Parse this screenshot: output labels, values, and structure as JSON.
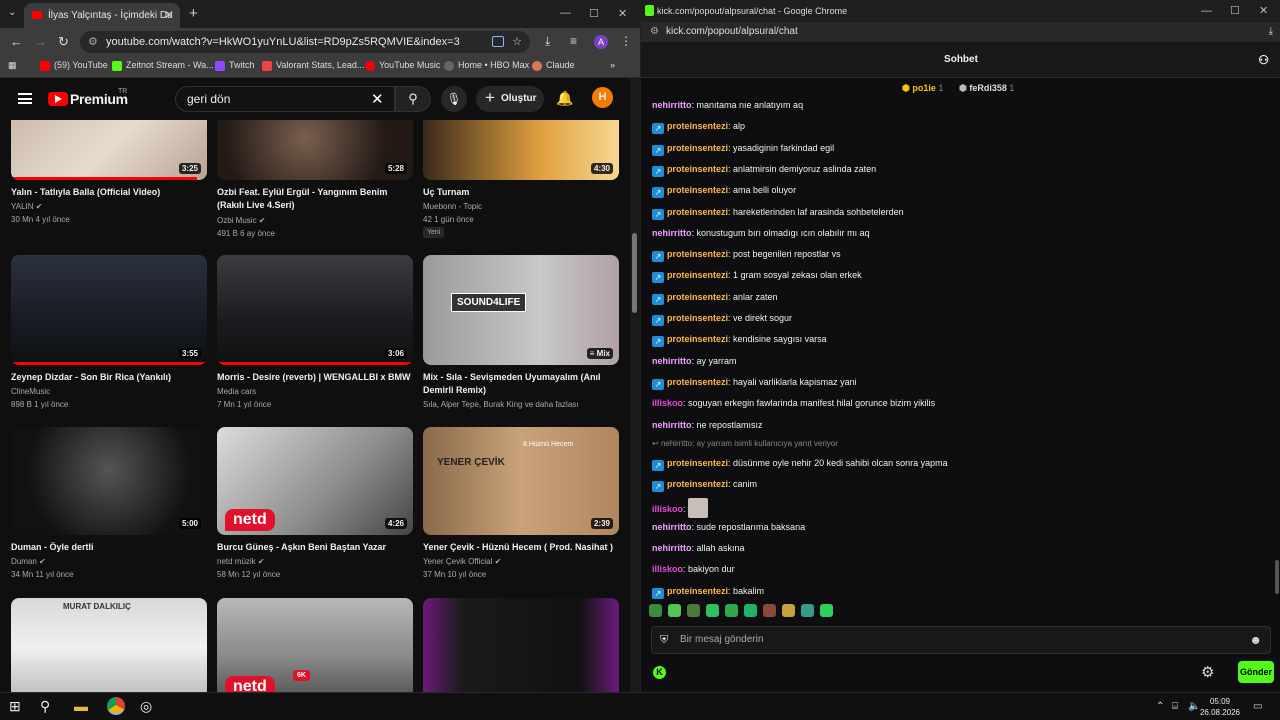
{
  "left_window": {
    "tab_title": "İlyas Yalçıntaş - İçimdeki Du",
    "url": "youtube.com/watch?v=HkWO1yuYnLU&list=RD9pZs5RQMVIE&index=3",
    "account_initial": "A",
    "bookmarks": [
      {
        "label": "(59) YouTube",
        "color": "#f00"
      },
      {
        "label": "Zeitnot Stream - Wa...",
        "color": "#53fc18"
      },
      {
        "label": "Twitch",
        "color": "#9146ff"
      },
      {
        "label": "Valorant Stats, Lead...",
        "color": "#e44"
      },
      {
        "label": "YouTube Music",
        "color": "#f00"
      },
      {
        "label": "Home • HBO Max",
        "color": "#666"
      },
      {
        "label": "Claude",
        "color": "#d97757"
      }
    ]
  },
  "youtube": {
    "logo_text": "Premium",
    "region": "TR",
    "search_value": "geri dön",
    "create_label": "Oluştur",
    "avatar_initial": "H",
    "videos": [
      {
        "title": "Yalın - Tatlıyla Balla (Official Video)",
        "channel": "YALIN",
        "meta": "30 Mn   4 yıl önce",
        "duration": "3:25",
        "verified": true,
        "progress": 0.95
      },
      {
        "title": "Ozbi Feat. Eylül Ergül - Yangınım Benim (Rakılı Live 4.Seri)",
        "channel": "Ozbi Music",
        "meta": "491 B   6 ay önce",
        "duration": "5:28",
        "verified": true,
        "progress": 0.0
      },
      {
        "title": "Uç Turnam",
        "channel": "Muebonn - Topic",
        "meta": "42   1 gün önce",
        "duration": "4:30",
        "verified": false,
        "badge": "Yeni",
        "progress": 0.0
      },
      {
        "title": "Zeynep Dizdar - Son Bir Rica (Yankılı)",
        "channel": "ClineMusic",
        "meta": "898 B   1 yıl önce",
        "duration": "3:55",
        "verified": false,
        "progress": 1.0
      },
      {
        "title": "Morris - Desire (reverb) | WENGALLBI x BMW",
        "channel": "Media cars",
        "meta": "7 Mn   1 yıl önce",
        "duration": "3:06",
        "verified": false,
        "progress": 1.0
      },
      {
        "title": "Mix - Sıla - Sevişmeden Uyumayalım (Anıl Demirli Remix)",
        "channel": "Sıla, Alper Tepe, Burak King ve daha fazlası",
        "meta": "",
        "duration": "Mix",
        "verified": false,
        "progress": 0.0
      },
      {
        "title": "Duman - Öyle dertli",
        "channel": "Duman",
        "meta": "34 Mn   11 yıl önce",
        "duration": "5:00",
        "verified": true,
        "progress": 0.0
      },
      {
        "title": "Burcu Güneş - Aşkın Beni Baştan Yazar",
        "channel": "netd müzik",
        "meta": "58 Mn   12 yıl önce",
        "duration": "4:26",
        "verified": true,
        "progress": 0.0
      },
      {
        "title": "Yener Çevik - Hüznü Hecem ( Prod. Nasihat )",
        "channel": "Yener Çevik Official",
        "meta": "37 Mn   10 yıl önce",
        "duration": "2:39",
        "verified": true,
        "progress": 0.0
      }
    ],
    "thumb_texts": {
      "sound4life": "SOUND4LIFE",
      "netd": "netd",
      "yener_album": "YENER ÇEVİK",
      "yener_track": "8.Hüznü Hecem",
      "murat": "MURAT DALKILIÇ",
      "sixk": "6K"
    }
  },
  "right_window": {
    "title": "kick.com/popout/alpsural/chat - Google Chrome",
    "url": "kick.com/popout/alpsural/chat",
    "chat_title": "Sohbet",
    "pinned": [
      {
        "name": "po1ie",
        "rank": "1"
      },
      {
        "name": "feRdi358",
        "rank": "1"
      }
    ],
    "messages": [
      {
        "user": "nehirritto",
        "text": "manıtama nıe anlatıyım aq",
        "badge": false,
        "color": "#f3a0ff"
      },
      {
        "user": "proteinsentezi",
        "text": "alp",
        "badge": true,
        "color": "#ffb74d"
      },
      {
        "user": "proteinsentezi",
        "text": "yasadiginin farkindad egil",
        "badge": true,
        "color": "#ffb74d"
      },
      {
        "user": "proteinsentezi",
        "text": "anlatmirsin demiyoruz aslinda zaten",
        "badge": true,
        "color": "#ffb74d"
      },
      {
        "user": "proteinsentezi",
        "text": "ama belli oluyor",
        "badge": true,
        "color": "#ffb74d"
      },
      {
        "user": "proteinsentezi",
        "text": "hareketlerinden laf arasinda sohbetelerden",
        "badge": true,
        "color": "#ffb74d"
      },
      {
        "user": "nehirritto",
        "text": "konustugum bırı olmadıgı ıcın olabılır mı aq",
        "badge": false,
        "color": "#f3a0ff"
      },
      {
        "user": "proteinsentezi",
        "text": "post begenileri repostlar vs",
        "badge": true,
        "color": "#ffb74d"
      },
      {
        "user": "proteinsentezi",
        "text": "1 gram sosyal zekası olan erkek",
        "badge": true,
        "color": "#ffb74d"
      },
      {
        "user": "proteinsentezi",
        "text": "anlar zaten",
        "badge": true,
        "color": "#ffb74d"
      },
      {
        "user": "proteinsentezi",
        "text": "ve direkt sogur",
        "badge": true,
        "color": "#ffb74d"
      },
      {
        "user": "proteinsentezi",
        "text": "kendisine saygısı varsa",
        "badge": true,
        "color": "#ffb74d"
      },
      {
        "user": "nehirritto",
        "text": "ay yarram",
        "badge": false,
        "color": "#f3a0ff"
      },
      {
        "user": "proteinsentezi",
        "text": "hayali varliklarla kapismaz yani",
        "badge": true,
        "color": "#ffb74d"
      },
      {
        "user": "illiskoo",
        "text": "soguyan erkegin fawlarinda manifest hilal gorunce bizim yikilis",
        "badge": false,
        "color": "#e54bd8"
      },
      {
        "user": "nehirritto",
        "text": "ne repostlamısız",
        "badge": false,
        "color": "#f3a0ff"
      },
      {
        "user": "proteinsentezi",
        "text": "düsünme oyle nehir 20 kedi sahibi olcan sonra yapma",
        "badge": true,
        "color": "#ffb74d"
      },
      {
        "user": "proteinsentezi",
        "text": "canim",
        "badge": true,
        "color": "#ffb74d"
      },
      {
        "user": "illiskoo",
        "text": "",
        "badge": false,
        "color": "#e54bd8"
      },
      {
        "user": "nehirritto",
        "text": "sude repostlarıma baksana",
        "badge": false,
        "color": "#f3a0ff"
      },
      {
        "user": "nehirritto",
        "text": "allah askına",
        "badge": false,
        "color": "#f3a0ff"
      },
      {
        "user": "illiskoo",
        "text": "bakiyon dur",
        "badge": false,
        "color": "#e54bd8"
      },
      {
        "user": "proteinsentezi",
        "text": "bakalim",
        "badge": true,
        "color": "#ffb74d"
      }
    ],
    "reply_note": "nehirritto: ay yarram isimli kullanıcıya yanıt veriyor",
    "input_placeholder": "Bir mesaj gönderin",
    "send_label": "Gönder"
  },
  "taskbar": {
    "time": "05:09",
    "date": "26.08.2026"
  }
}
